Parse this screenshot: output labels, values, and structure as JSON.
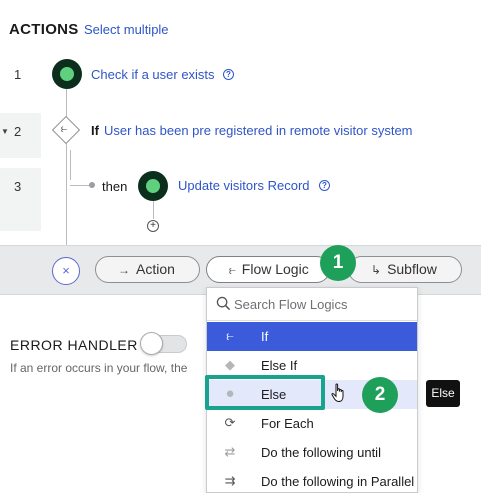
{
  "header": {
    "title": "ACTIONS",
    "select_multiple": "Select multiple"
  },
  "steps": [
    {
      "number": "1",
      "label": "Check if a user exists",
      "help": "?"
    },
    {
      "number": "2",
      "keyword": "If",
      "condition": "User has been pre registered in remote visitor system",
      "collapse_marker": "▼"
    },
    {
      "number": "3",
      "keyword": "then",
      "label": "Update visitors Record",
      "help": "?"
    }
  ],
  "add_step_symbol": "+",
  "toolbar": {
    "close_symbol": "×",
    "action_label": "Action",
    "action_icon": "→",
    "flow_logic_label": "Flow Logic",
    "flow_logic_icon": "⥼",
    "subflow_label": "Subflow",
    "subflow_icon": "↳"
  },
  "callouts": {
    "first": "1",
    "second": "2",
    "color": "#1fa05a",
    "highlight": "#19a38f"
  },
  "error_handler": {
    "title": "ERROR HANDLER",
    "description": "If an error occurs in your flow, the",
    "enabled": false
  },
  "flow_logic_menu": {
    "search_placeholder": "Search Flow Logics",
    "items": [
      {
        "label": "If",
        "icon": "branch-icon",
        "glyph": "⥼",
        "state": "selected"
      },
      {
        "label": "Else If",
        "icon": "diamond-icon",
        "glyph": "◆",
        "state": "normal"
      },
      {
        "label": "Else",
        "icon": "circle-icon",
        "glyph": "●",
        "state": "hover"
      },
      {
        "label": "For Each",
        "icon": "loop-icon",
        "glyph": "⟳",
        "state": "normal"
      },
      {
        "label": "Do the following until",
        "icon": "repeat-icon",
        "glyph": "⇄",
        "state": "normal"
      },
      {
        "label": "Do the following in Parallel",
        "icon": "parallel-icon",
        "glyph": "⇉",
        "state": "normal"
      }
    ]
  },
  "tooltip": {
    "text": "Else"
  },
  "colors": {
    "link": "#2f55c8",
    "selected": "#3b5bdb",
    "hover": "#e3e8fb",
    "node_green": "#5fd17e"
  }
}
